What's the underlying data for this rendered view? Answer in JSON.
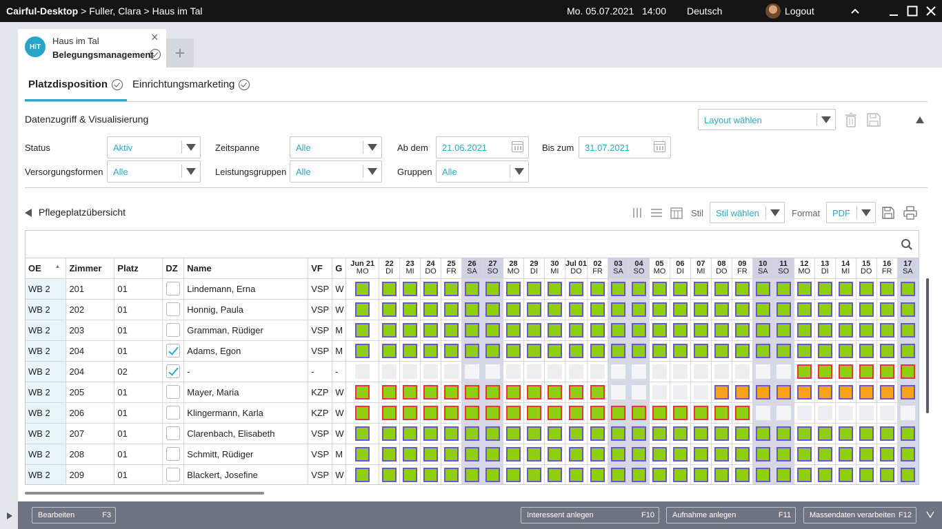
{
  "topbar": {
    "app": "Cairful-Desktop",
    "crumb_rest": " > Fuller, Clara > Haus im Tal",
    "datetime": "Mo. 05.07.2021   14:00",
    "language": "Deutsch",
    "logout": "Logout"
  },
  "apptab": {
    "badge": "HiT",
    "line1": "Haus im Tal",
    "line2": "Belegungsmanagement"
  },
  "subtabs": [
    "Platzdisposition",
    "Einrichtungsmarketing"
  ],
  "datenzugriff": {
    "title": "Datenzugriff & Visualisierung",
    "layout_select": "Layout wählen",
    "filters": {
      "status": {
        "label": "Status",
        "value": "Aktiv"
      },
      "zeitspanne": {
        "label": "Zeitspanne",
        "value": "Alle"
      },
      "ab_dem": {
        "label": "Ab dem",
        "value": "21.06.2021"
      },
      "bis_zum": {
        "label": "Bis zum",
        "value": "31.07.2021"
      },
      "versorgungsformen": {
        "label": "Versorgungsformen",
        "value": "Alle"
      },
      "leistungsgruppen": {
        "label": "Leistungsgruppen",
        "value": "Alle"
      },
      "gruppen": {
        "label": "Gruppen",
        "value": "Alle"
      }
    }
  },
  "overview": {
    "title": "Pflegeplatzübersicht",
    "stil_label": "Stil",
    "stil_value": "Stil wählen",
    "format_label": "Format",
    "format_value": "PDF"
  },
  "grid": {
    "columns": {
      "oe": "OE",
      "zimmer": "Zimmer",
      "platz": "Platz",
      "dz": "DZ",
      "name": "Name",
      "vf": "VF",
      "g": "G"
    },
    "days": [
      {
        "d": "Jun 21",
        "w": "MO"
      },
      {
        "d": "22",
        "w": "DI"
      },
      {
        "d": "23",
        "w": "MI"
      },
      {
        "d": "24",
        "w": "DO"
      },
      {
        "d": "25",
        "w": "FR"
      },
      {
        "d": "26",
        "w": "SA"
      },
      {
        "d": "27",
        "w": "SO"
      },
      {
        "d": "28",
        "w": "MO"
      },
      {
        "d": "29",
        "w": "DI"
      },
      {
        "d": "30",
        "w": "MI"
      },
      {
        "d": "Jul 01",
        "w": "DO"
      },
      {
        "d": "02",
        "w": "FR"
      },
      {
        "d": "03",
        "w": "SA"
      },
      {
        "d": "04",
        "w": "SO"
      },
      {
        "d": "05",
        "w": "MO"
      },
      {
        "d": "06",
        "w": "DI"
      },
      {
        "d": "07",
        "w": "MI"
      },
      {
        "d": "08",
        "w": "DO"
      },
      {
        "d": "09",
        "w": "FR"
      },
      {
        "d": "10",
        "w": "SA"
      },
      {
        "d": "11",
        "w": "SO"
      },
      {
        "d": "12",
        "w": "MO"
      },
      {
        "d": "13",
        "w": "DI"
      },
      {
        "d": "14",
        "w": "MI"
      },
      {
        "d": "15",
        "w": "DO"
      },
      {
        "d": "16",
        "w": "FR"
      },
      {
        "d": "17",
        "w": "SA"
      }
    ],
    "legend": {
      "g": "occupied",
      "r": "occupied-unconfirmed",
      "o": "reserved",
      "or": "reserved-unconfirmed",
      "e": "free"
    },
    "rows": [
      {
        "oe": "WB 2",
        "zimmer": "201",
        "platz": "01",
        "dz": false,
        "name": "Lindemann, Erna",
        "vf": "VSP",
        "g": "W",
        "cells": "ggggggggggggggggggggggggggg"
      },
      {
        "oe": "WB 2",
        "zimmer": "202",
        "platz": "01",
        "dz": false,
        "name": "Honnig, Paula",
        "vf": "VSP",
        "g": "W",
        "cells": "ggggggggggggggggggggggggggg"
      },
      {
        "oe": "WB 2",
        "zimmer": "203",
        "platz": "01",
        "dz": false,
        "name": "Gramman, Rüdiger",
        "vf": "VSP",
        "g": "M",
        "cells": "ggggggggggggggggggggggggggg"
      },
      {
        "oe": "WB 2",
        "zimmer": "204",
        "platz": "01",
        "dz": true,
        "name": "Adams, Egon",
        "vf": "VSP",
        "g": "M",
        "cells": "ggggggggggggggggggggggggggg"
      },
      {
        "oe": "WB 2",
        "zimmer": "204",
        "platz": "02",
        "dz": true,
        "name": "-",
        "vf": "-",
        "g": "-",
        "cells": "eeeeeeeeeeeeeeeeeeeeerrrrrr"
      },
      {
        "oe": "WB 2",
        "zimmer": "205",
        "platz": "01",
        "dz": false,
        "name": "Mayer, Maria",
        "vf": "KZP",
        "g": "W",
        "cells": "rrrrrrrrrrrreeeeeoooooooooo"
      },
      {
        "oe": "WB 2",
        "zimmer": "206",
        "platz": "01",
        "dz": false,
        "name": "Klingermann, Karla",
        "vf": "KZP",
        "g": "W",
        "cells": "rrrrrrrrrrrrrrrrrrreeeeeeee"
      },
      {
        "oe": "WB 2",
        "zimmer": "207",
        "platz": "01",
        "dz": false,
        "name": "Clarenbach, Elisabeth",
        "vf": "VSP",
        "g": "W",
        "cells": "ggggggggggggggggggggggggggg"
      },
      {
        "oe": "WB 2",
        "zimmer": "208",
        "platz": "01",
        "dz": false,
        "name": "Schmitt, Rüdiger",
        "vf": "VSP",
        "g": "M",
        "cells": "ggggggggggggggggggggggggggg"
      },
      {
        "oe": "WB 2",
        "zimmer": "209",
        "platz": "01",
        "dz": false,
        "name": "Blackert, Josefine",
        "vf": "VSP",
        "g": "W",
        "cells": "ggggggggggggggggggggggggggg"
      }
    ]
  },
  "footer": {
    "bearbeiten": {
      "label": "Bearbeiten",
      "key": "F3"
    },
    "interessent": {
      "label": "Interessent anlegen",
      "key": "F10"
    },
    "aufnahme": {
      "label": "Aufnahme anlegen",
      "key": "F11"
    },
    "massendaten": {
      "label": "Massendaten verarbeiten",
      "key": "F12"
    }
  },
  "colors": {
    "accent": "#2aa7c9",
    "occupied": "#8fcf10",
    "reserved": "#fba21c",
    "border_confirmed": "#6b58c6",
    "border_unconfirmed": "#ea3340",
    "weekend": "#d8d9e8"
  }
}
